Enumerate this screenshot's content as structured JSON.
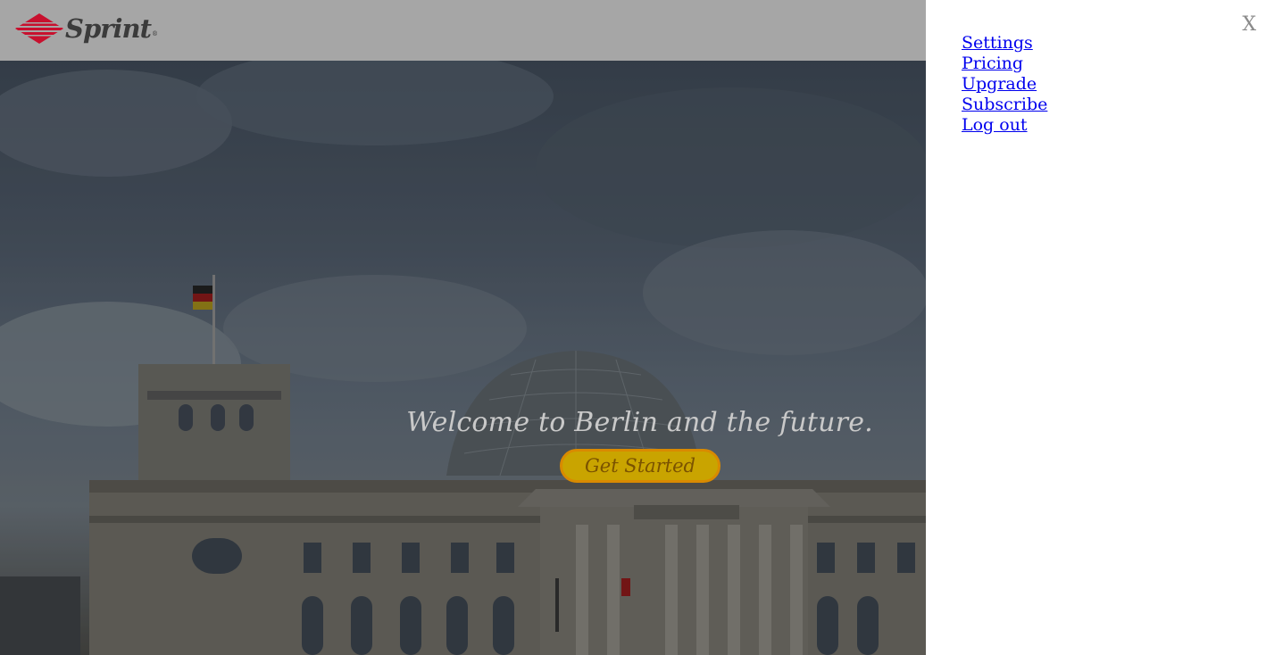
{
  "header": {
    "logo_text": "Sprint",
    "logo_reg": "®"
  },
  "hero": {
    "title": "Welcome to Berlin and the future.",
    "cta_label": "Get Started"
  },
  "menu": {
    "close_label": "X",
    "items": [
      {
        "label": "Settings"
      },
      {
        "label": "Pricing"
      },
      {
        "label": "Upgrade"
      },
      {
        "label": "Subscribe"
      },
      {
        "label": "Log out"
      }
    ]
  },
  "colors": {
    "accent_red": "#c8102e",
    "cta_fill": "#c9a400",
    "cta_border": "#d98a00",
    "link": "#0000ee"
  }
}
